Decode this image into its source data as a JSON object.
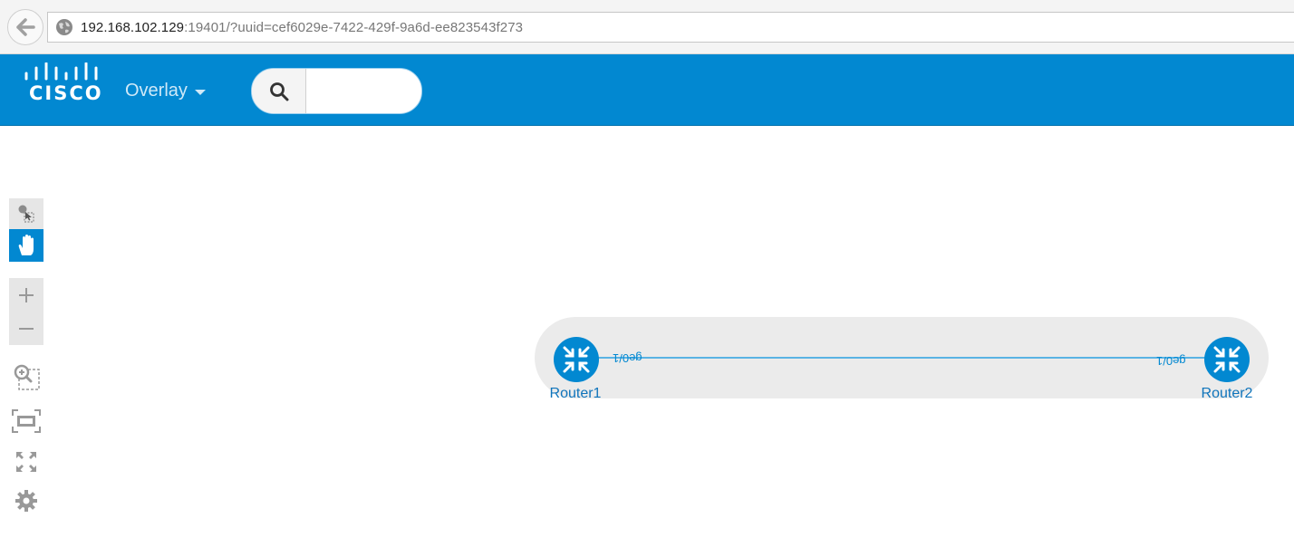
{
  "browser": {
    "url_host": "192.168.102.129",
    "url_rest": ":19401/?uuid=cef6029e-7422-429f-9a6d-ee823543f273",
    "back_icon": "back-arrow-icon",
    "site_icon": "globe-icon"
  },
  "header": {
    "logo_text": "CISCO",
    "menu_label": "Overlay",
    "search_placeholder": "",
    "search_value": "",
    "brand_color": "#0288d1"
  },
  "toolbar": {
    "select_tool": "select-icon",
    "pan_tool": "hand-icon",
    "active_tool": "pan",
    "zoom_in": "plus-icon",
    "zoom_out": "minus-icon",
    "zoom_region": "zoom-region-icon",
    "fit": "fit-screen-icon",
    "fullscreen": "fullscreen-icon",
    "settings": "gear-icon"
  },
  "topology": {
    "nodes": [
      {
        "name": "Router1",
        "icon": "router-icon"
      },
      {
        "name": "Router2",
        "icon": "router-icon"
      }
    ],
    "link": {
      "source_port": "ge0/1",
      "target_port": "ge0/1",
      "color": "#5ab3e4"
    }
  }
}
